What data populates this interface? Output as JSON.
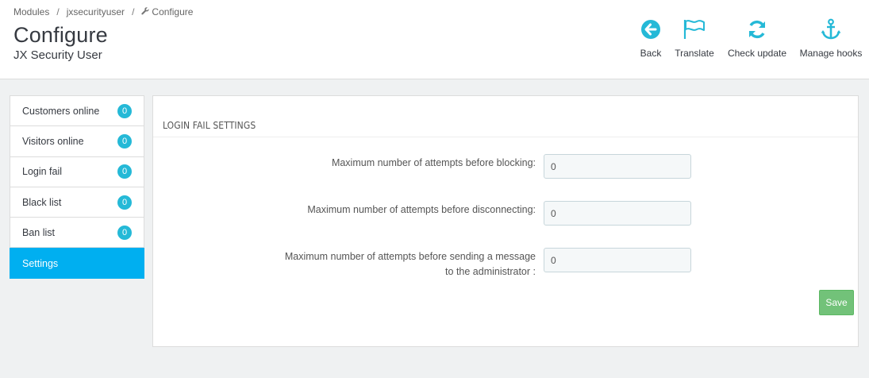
{
  "breadcrumb": {
    "items": [
      "Modules",
      "jxsecurityuser",
      "Configure"
    ],
    "separator": "/"
  },
  "header": {
    "title": "Configure",
    "subtitle": "JX Security User"
  },
  "toolbar": {
    "accent_color": "#25b9d7",
    "buttons": [
      {
        "label": "Back",
        "icon": "back-circle-icon"
      },
      {
        "label": "Translate",
        "icon": "flag-icon"
      },
      {
        "label": "Check update",
        "icon": "refresh-icon"
      },
      {
        "label": "Manage hooks",
        "icon": "anchor-icon"
      }
    ]
  },
  "sidebar": {
    "items": [
      {
        "label": "Customers online",
        "count": "0"
      },
      {
        "label": "Visitors online",
        "count": "0"
      },
      {
        "label": "Login fail",
        "count": "0"
      },
      {
        "label": "Black list",
        "count": "0"
      },
      {
        "label": "Ban list",
        "count": "0"
      },
      {
        "label": "Settings",
        "active": true
      }
    ],
    "active_color": "#00aff0"
  },
  "panel": {
    "heading": "LOGIN FAIL SETTINGS",
    "fields": [
      {
        "label": "Maximum number of attempts before blocking:",
        "value": "0"
      },
      {
        "label": "Maximum number of attempts before disconnecting:",
        "value": "0"
      },
      {
        "label": "Maximum number of attempts before sending a message to the administrator :",
        "value": "0"
      }
    ],
    "save_label": "Save",
    "save_color": "#72c279"
  }
}
